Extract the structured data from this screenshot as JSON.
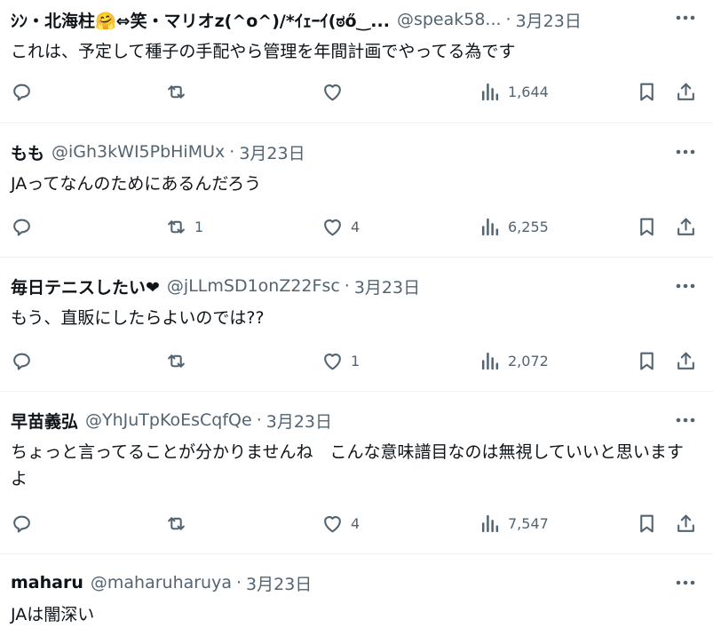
{
  "tweets": [
    {
      "name": "ｼﾝ・北海柱🤗⇔笑・マリオz(^o^)/*ｲｪｰｲ(ಠő‿...",
      "handle": "@speak58...",
      "date": "3月23日",
      "text": "これは、予定して種子の手配やら管理を年間計画でやってる為です",
      "replies": "",
      "retweets": "",
      "likes": "",
      "views": "1,644"
    },
    {
      "name": "もも",
      "handle": "@iGh3kWI5PbHiMUx",
      "date": "3月23日",
      "text": "JAってなんのためにあるんだろう",
      "replies": "",
      "retweets": "1",
      "likes": "4",
      "views": "6,255"
    },
    {
      "name": "毎日テニスしたい❤",
      "handle": "@jLLmSD1onZ22Fsc",
      "date": "3月23日",
      "text": "もう、直販にしたらよいのでは??",
      "replies": "",
      "retweets": "",
      "likes": "1",
      "views": "2,072"
    },
    {
      "name": "早苗義弘",
      "handle": "@YhJuTpKoEsCqfQe",
      "date": "3月23日",
      "text": "ちょっと言ってることが分かりませんね　こんな意味譜目なのは無視していいと思いますよ",
      "replies": "",
      "retweets": "",
      "likes": "4",
      "views": "7,547"
    },
    {
      "name": "maharu",
      "handle": "@maharuharuya",
      "date": "3月23日",
      "text": "JAは闇深い"
    }
  ],
  "colors": {
    "text": "#0f1419",
    "muted": "#536471",
    "divider": "#eff3f4"
  },
  "icons": [
    "reply-icon",
    "retweet-icon",
    "like-icon",
    "views-icon",
    "bookmark-icon",
    "share-icon",
    "more-icon"
  ]
}
